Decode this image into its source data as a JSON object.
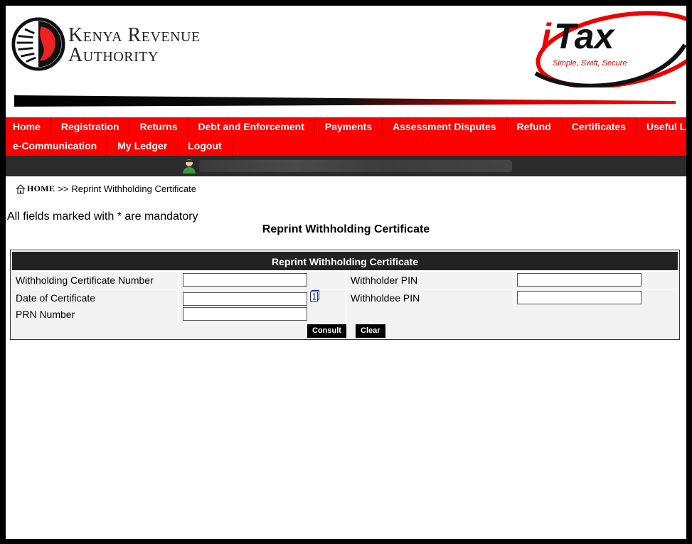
{
  "header": {
    "org_line1": "Kenya Revenue",
    "org_line2": "Authority",
    "itax_brand": "iTax",
    "itax_tagline": "Simple, Swift, Secure"
  },
  "nav": {
    "row1": [
      "Home",
      "Registration",
      "Returns",
      "Debt and Enforcement",
      "Payments",
      "Assessment Disputes",
      "Refund",
      "Certificates",
      "Useful Links"
    ],
    "row2": [
      "e-Communication",
      "My Ledger",
      "Logout"
    ]
  },
  "breadcrumb": {
    "home": "HOME",
    "separator": ">>",
    "current": "Reprint Withholding Certificate"
  },
  "mandatory_note": "All fields marked with * are mandatory",
  "page_title": "Reprint Withholding Certificate",
  "form": {
    "section_title": "Reprint Withholding Certificate",
    "fields": {
      "certificate_number": {
        "label": "Withholding Certificate Number",
        "value": ""
      },
      "date_of_certificate": {
        "label": "Date of Certificate",
        "value": ""
      },
      "prn_number": {
        "label": "PRN Number",
        "value": ""
      },
      "withholder_pin": {
        "label": "Withholder PIN",
        "value": ""
      },
      "withholdee_pin": {
        "label": "Withholdee PIN",
        "value": ""
      }
    },
    "buttons": {
      "consult": "Consult",
      "clear": "Clear"
    }
  },
  "colors": {
    "brand_red": "#ff0000",
    "dark_bar": "#2b2b2b",
    "table_head": "#222222"
  }
}
